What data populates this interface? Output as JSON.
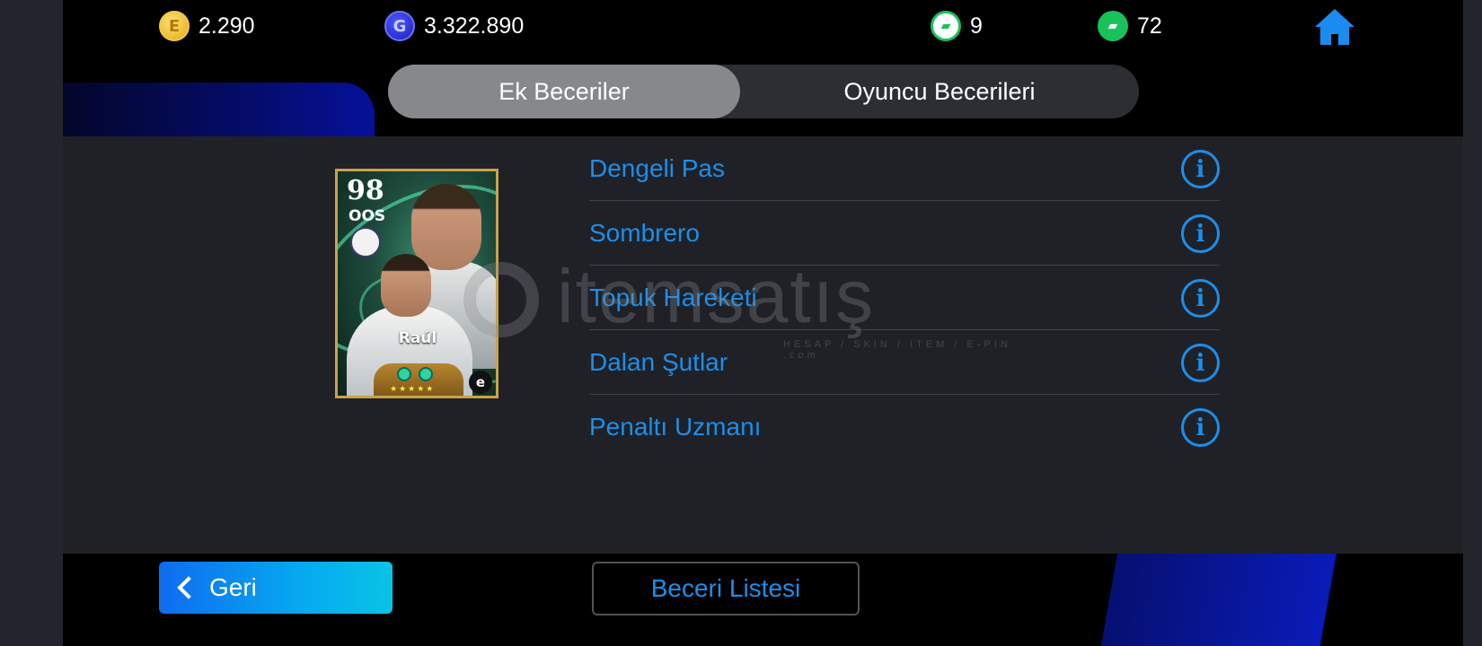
{
  "currencies": {
    "coins": {
      "icon": "coin-icon",
      "value": "2.290"
    },
    "gp": {
      "icon": "gp-icon",
      "value": "3.322.890"
    },
    "boot_outline": {
      "icon": "boot-outline-icon",
      "value": "9"
    },
    "boot_filled": {
      "icon": "boot-filled-icon",
      "value": "72"
    }
  },
  "home": {
    "icon": "home-icon"
  },
  "tabs": [
    {
      "label": "Ek Beceriler",
      "active": true
    },
    {
      "label": "Oyuncu Becerileri",
      "active": false
    }
  ],
  "player_card": {
    "rating": "98",
    "position": "OOS",
    "name": "Raúl",
    "stars": "★★★★★"
  },
  "skills": [
    {
      "name": "Dengeli Pas"
    },
    {
      "name": "Sombrero"
    },
    {
      "name": "Topuk Hareketi"
    },
    {
      "name": "Dalan Şutlar"
    },
    {
      "name": "Penaltı Uzmanı"
    }
  ],
  "watermark": {
    "brand": "itemsatış",
    "tagline": "HESAP / SKIN / ITEM / E-PIN .com"
  },
  "footer": {
    "back_label": "Geri",
    "skill_list_label": "Beceri Listesi"
  },
  "colors": {
    "accent_blue": "#1c8eeb",
    "tab_active": "#86888c",
    "boot_green": "#19c15a"
  }
}
